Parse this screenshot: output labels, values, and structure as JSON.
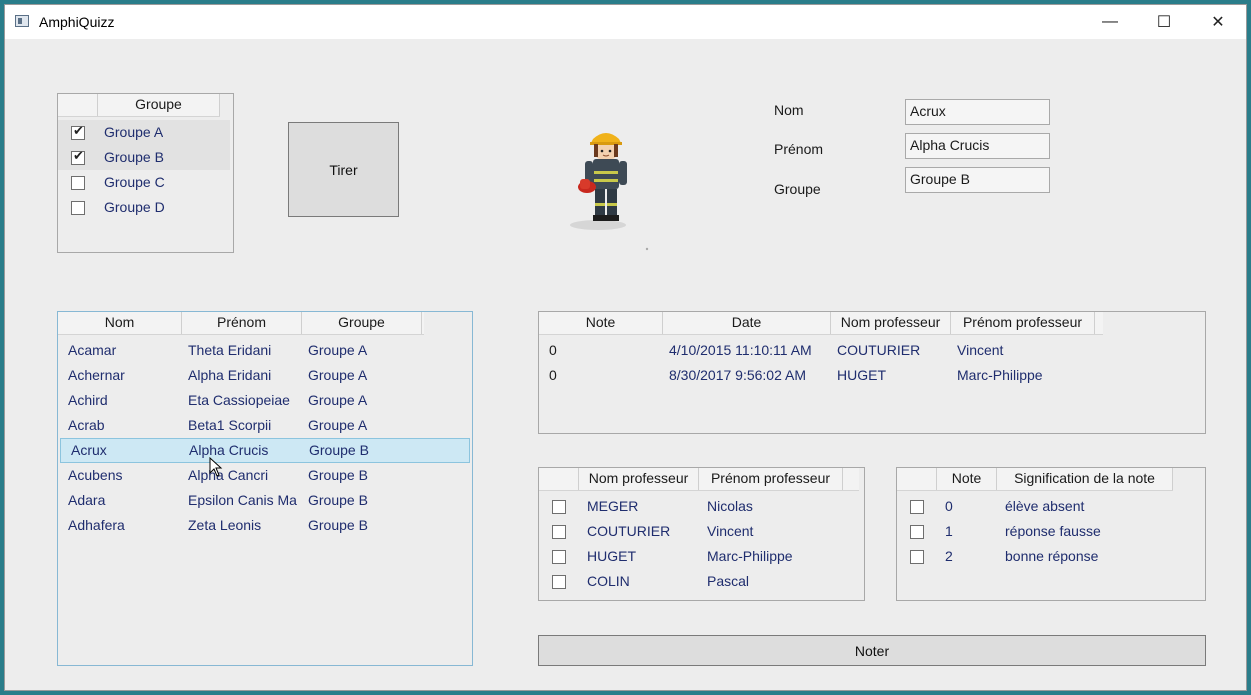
{
  "window": {
    "title": "AmphiQuizz",
    "minimize_glyph": "—",
    "maximize_glyph": "☐",
    "close_glyph": "✕"
  },
  "groups_panel": {
    "header": "Groupe",
    "items": [
      {
        "label": "Groupe A",
        "checked": true
      },
      {
        "label": "Groupe B",
        "checked": true
      },
      {
        "label": "Groupe C",
        "checked": false
      },
      {
        "label": "Groupe D",
        "checked": false
      }
    ]
  },
  "draw_button": {
    "label": "Tirer"
  },
  "student_details": {
    "nom_label": "Nom",
    "nom_value": "Acrux",
    "prenom_label": "Prénom",
    "prenom_value": "Alpha Crucis",
    "groupe_label": "Groupe",
    "groupe_value": "Groupe B"
  },
  "students_table": {
    "headers": [
      "Nom",
      "Prénom",
      "Groupe"
    ],
    "rows": [
      [
        "Acamar",
        "Theta Eridani",
        "Groupe A"
      ],
      [
        "Achernar",
        "Alpha Eridani",
        "Groupe A"
      ],
      [
        "Achird",
        "Eta Cassiopeiae",
        "Groupe A"
      ],
      [
        "Acrab",
        "Beta1 Scorpii",
        "Groupe A"
      ],
      [
        "Acrux",
        "Alpha Crucis",
        "Groupe B"
      ],
      [
        "Acubens",
        "Alpha Cancri",
        "Groupe B"
      ],
      [
        "Adara",
        "Epsilon Canis Ma",
        "Groupe B"
      ],
      [
        "Adhafera",
        "Zeta Leonis",
        "Groupe B"
      ]
    ],
    "selected_row": "Acrux"
  },
  "grades_table": {
    "headers": [
      "Note",
      "Date",
      "Nom professeur",
      "Prénom professeur"
    ],
    "rows": [
      [
        "0",
        "4/10/2015 11:10:11 AM",
        "COUTURIER",
        "Vincent"
      ],
      [
        "0",
        "8/30/2017 9:56:02 AM",
        "HUGET",
        "Marc-Philippe"
      ]
    ]
  },
  "teachers_table": {
    "headers": [
      "",
      "Nom professeur",
      "Prénom professeur"
    ],
    "rows": [
      [
        "MEGER",
        "Nicolas"
      ],
      [
        "COUTURIER",
        "Vincent"
      ],
      [
        "HUGET",
        "Marc-Philippe"
      ],
      [
        "COLIN",
        "Pascal"
      ]
    ]
  },
  "meaning_table": {
    "headers": [
      "",
      "Note",
      "Signification de la note"
    ],
    "rows": [
      [
        "0",
        "élève absent"
      ],
      [
        "1",
        "réponse fausse"
      ],
      [
        "2",
        "bonne réponse"
      ]
    ]
  },
  "grade_button": {
    "label": "Noter"
  },
  "colors": {
    "selection": "#cde8f4",
    "link_text": "#1f2d6e",
    "helmet": "#f0b21a"
  }
}
